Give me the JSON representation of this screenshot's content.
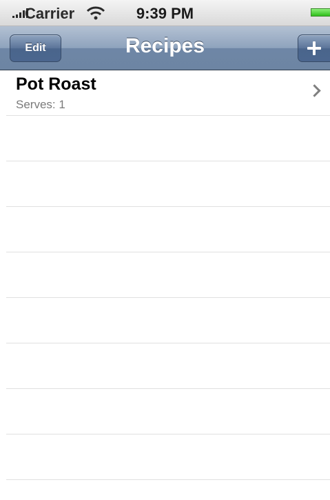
{
  "status_bar": {
    "carrier": "Carrier",
    "time": "9:39 PM",
    "icons": [
      "signal-icon",
      "wifi-icon",
      "battery-icon"
    ]
  },
  "nav_bar": {
    "title": "Recipes",
    "edit_label": "Edit",
    "add_icon": "plus-icon"
  },
  "recipes": [
    {
      "name": "Pot Roast",
      "serves": "Serves: 1"
    }
  ],
  "colors": {
    "nav_bar": "#6d85a3",
    "button": "#4b668e",
    "subtitle_text": "#7a7a7a",
    "separator": "#e0e0e0"
  }
}
